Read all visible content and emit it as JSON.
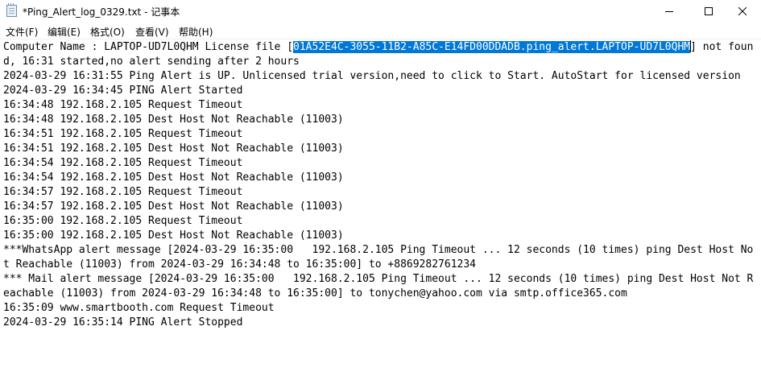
{
  "window": {
    "title": "*Ping_Alert_log_0329.txt - 记事本",
    "icon": "notepad-icon"
  },
  "menu": {
    "items": [
      {
        "label": "文件(F)"
      },
      {
        "label": "编辑(E)"
      },
      {
        "label": "格式(O)"
      },
      {
        "label": "查看(V)"
      },
      {
        "label": "帮助(H)"
      }
    ]
  },
  "document": {
    "first_line_prefix": "Computer Name : LAPTOP-UD7L0QHM License file [",
    "selected_text": "01A52E4C-3055-11B2-A85C-E14FD00DDADB.ping_alert.LAPTOP-UD7L0QHM",
    "first_line_suffix": "] not found, 16:31 started,no alert sending after 2 hours",
    "lines": [
      "2024-03-29 16:31:55 Ping Alert is UP. Unlicensed trial version,need to click to Start. AutoStart for licensed version",
      "2024-03-29 16:34:45 PING Alert Started",
      "16:34:48 192.168.2.105 Request Timeout",
      "16:34:48 192.168.2.105 Dest Host Not Reachable (11003)",
      "16:34:51 192.168.2.105 Request Timeout",
      "16:34:51 192.168.2.105 Dest Host Not Reachable (11003)",
      "16:34:54 192.168.2.105 Request Timeout",
      "16:34:54 192.168.2.105 Dest Host Not Reachable (11003)",
      "16:34:57 192.168.2.105 Request Timeout",
      "16:34:57 192.168.2.105 Dest Host Not Reachable (11003)",
      "16:35:00 192.168.2.105 Request Timeout",
      "16:35:00 192.168.2.105 Dest Host Not Reachable (11003)",
      "***WhatsApp alert message [2024-03-29 16:35:00   192.168.2.105 Ping Timeout ... 12 seconds (10 times) ping Dest Host Not Reachable (11003) from 2024-03-29 16:34:48 to 16:35:00] to +8869282761234",
      "*** Mail alert message [2024-03-29 16:35:00   192.168.2.105 Ping Timeout ... 12 seconds (10 times) ping Dest Host Not Reachable (11003) from 2024-03-29 16:34:48 to 16:35:00] to tonychen@yahoo.com via smtp.office365.com",
      "16:35:09 www.smartbooth.com Request Timeout",
      "2024-03-29 16:35:14 PING Alert Stopped"
    ]
  },
  "colors": {
    "selection": "#0078d7",
    "background": "#ffffff",
    "text": "#000000"
  }
}
